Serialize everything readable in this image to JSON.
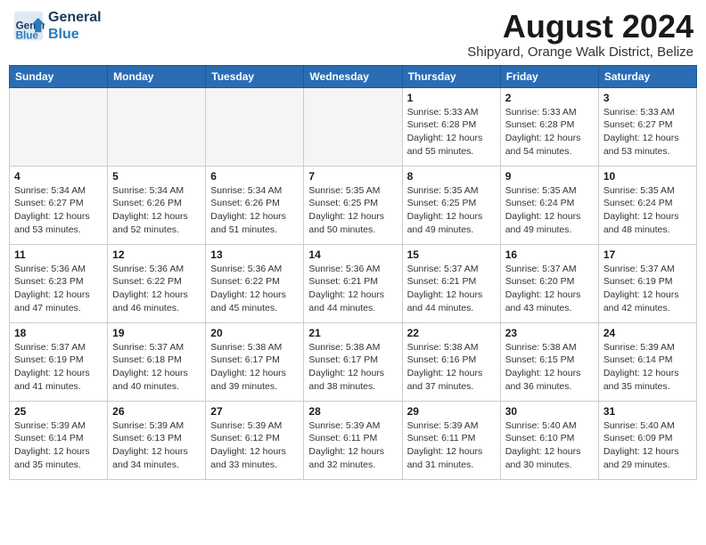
{
  "logo": {
    "text_general": "General",
    "text_blue": "Blue"
  },
  "title": "August 2024",
  "subtitle": "Shipyard, Orange Walk District, Belize",
  "days_of_week": [
    "Sunday",
    "Monday",
    "Tuesday",
    "Wednesday",
    "Thursday",
    "Friday",
    "Saturday"
  ],
  "weeks": [
    {
      "bg": "light",
      "days": [
        {
          "num": "",
          "info": "",
          "empty": true
        },
        {
          "num": "",
          "info": "",
          "empty": true
        },
        {
          "num": "",
          "info": "",
          "empty": true
        },
        {
          "num": "",
          "info": "",
          "empty": true
        },
        {
          "num": "1",
          "info": "Sunrise: 5:33 AM\nSunset: 6:28 PM\nDaylight: 12 hours\nand 55 minutes.",
          "empty": false
        },
        {
          "num": "2",
          "info": "Sunrise: 5:33 AM\nSunset: 6:28 PM\nDaylight: 12 hours\nand 54 minutes.",
          "empty": false
        },
        {
          "num": "3",
          "info": "Sunrise: 5:33 AM\nSunset: 6:27 PM\nDaylight: 12 hours\nand 53 minutes.",
          "empty": false
        }
      ]
    },
    {
      "bg": "gray",
      "days": [
        {
          "num": "4",
          "info": "Sunrise: 5:34 AM\nSunset: 6:27 PM\nDaylight: 12 hours\nand 53 minutes.",
          "empty": false
        },
        {
          "num": "5",
          "info": "Sunrise: 5:34 AM\nSunset: 6:26 PM\nDaylight: 12 hours\nand 52 minutes.",
          "empty": false
        },
        {
          "num": "6",
          "info": "Sunrise: 5:34 AM\nSunset: 6:26 PM\nDaylight: 12 hours\nand 51 minutes.",
          "empty": false
        },
        {
          "num": "7",
          "info": "Sunrise: 5:35 AM\nSunset: 6:25 PM\nDaylight: 12 hours\nand 50 minutes.",
          "empty": false
        },
        {
          "num": "8",
          "info": "Sunrise: 5:35 AM\nSunset: 6:25 PM\nDaylight: 12 hours\nand 49 minutes.",
          "empty": false
        },
        {
          "num": "9",
          "info": "Sunrise: 5:35 AM\nSunset: 6:24 PM\nDaylight: 12 hours\nand 49 minutes.",
          "empty": false
        },
        {
          "num": "10",
          "info": "Sunrise: 5:35 AM\nSunset: 6:24 PM\nDaylight: 12 hours\nand 48 minutes.",
          "empty": false
        }
      ]
    },
    {
      "bg": "light",
      "days": [
        {
          "num": "11",
          "info": "Sunrise: 5:36 AM\nSunset: 6:23 PM\nDaylight: 12 hours\nand 47 minutes.",
          "empty": false
        },
        {
          "num": "12",
          "info": "Sunrise: 5:36 AM\nSunset: 6:22 PM\nDaylight: 12 hours\nand 46 minutes.",
          "empty": false
        },
        {
          "num": "13",
          "info": "Sunrise: 5:36 AM\nSunset: 6:22 PM\nDaylight: 12 hours\nand 45 minutes.",
          "empty": false
        },
        {
          "num": "14",
          "info": "Sunrise: 5:36 AM\nSunset: 6:21 PM\nDaylight: 12 hours\nand 44 minutes.",
          "empty": false
        },
        {
          "num": "15",
          "info": "Sunrise: 5:37 AM\nSunset: 6:21 PM\nDaylight: 12 hours\nand 44 minutes.",
          "empty": false
        },
        {
          "num": "16",
          "info": "Sunrise: 5:37 AM\nSunset: 6:20 PM\nDaylight: 12 hours\nand 43 minutes.",
          "empty": false
        },
        {
          "num": "17",
          "info": "Sunrise: 5:37 AM\nSunset: 6:19 PM\nDaylight: 12 hours\nand 42 minutes.",
          "empty": false
        }
      ]
    },
    {
      "bg": "gray",
      "days": [
        {
          "num": "18",
          "info": "Sunrise: 5:37 AM\nSunset: 6:19 PM\nDaylight: 12 hours\nand 41 minutes.",
          "empty": false
        },
        {
          "num": "19",
          "info": "Sunrise: 5:37 AM\nSunset: 6:18 PM\nDaylight: 12 hours\nand 40 minutes.",
          "empty": false
        },
        {
          "num": "20",
          "info": "Sunrise: 5:38 AM\nSunset: 6:17 PM\nDaylight: 12 hours\nand 39 minutes.",
          "empty": false
        },
        {
          "num": "21",
          "info": "Sunrise: 5:38 AM\nSunset: 6:17 PM\nDaylight: 12 hours\nand 38 minutes.",
          "empty": false
        },
        {
          "num": "22",
          "info": "Sunrise: 5:38 AM\nSunset: 6:16 PM\nDaylight: 12 hours\nand 37 minutes.",
          "empty": false
        },
        {
          "num": "23",
          "info": "Sunrise: 5:38 AM\nSunset: 6:15 PM\nDaylight: 12 hours\nand 36 minutes.",
          "empty": false
        },
        {
          "num": "24",
          "info": "Sunrise: 5:39 AM\nSunset: 6:14 PM\nDaylight: 12 hours\nand 35 minutes.",
          "empty": false
        }
      ]
    },
    {
      "bg": "light",
      "days": [
        {
          "num": "25",
          "info": "Sunrise: 5:39 AM\nSunset: 6:14 PM\nDaylight: 12 hours\nand 35 minutes.",
          "empty": false
        },
        {
          "num": "26",
          "info": "Sunrise: 5:39 AM\nSunset: 6:13 PM\nDaylight: 12 hours\nand 34 minutes.",
          "empty": false
        },
        {
          "num": "27",
          "info": "Sunrise: 5:39 AM\nSunset: 6:12 PM\nDaylight: 12 hours\nand 33 minutes.",
          "empty": false
        },
        {
          "num": "28",
          "info": "Sunrise: 5:39 AM\nSunset: 6:11 PM\nDaylight: 12 hours\nand 32 minutes.",
          "empty": false
        },
        {
          "num": "29",
          "info": "Sunrise: 5:39 AM\nSunset: 6:11 PM\nDaylight: 12 hours\nand 31 minutes.",
          "empty": false
        },
        {
          "num": "30",
          "info": "Sunrise: 5:40 AM\nSunset: 6:10 PM\nDaylight: 12 hours\nand 30 minutes.",
          "empty": false
        },
        {
          "num": "31",
          "info": "Sunrise: 5:40 AM\nSunset: 6:09 PM\nDaylight: 12 hours\nand 29 minutes.",
          "empty": false
        }
      ]
    }
  ]
}
